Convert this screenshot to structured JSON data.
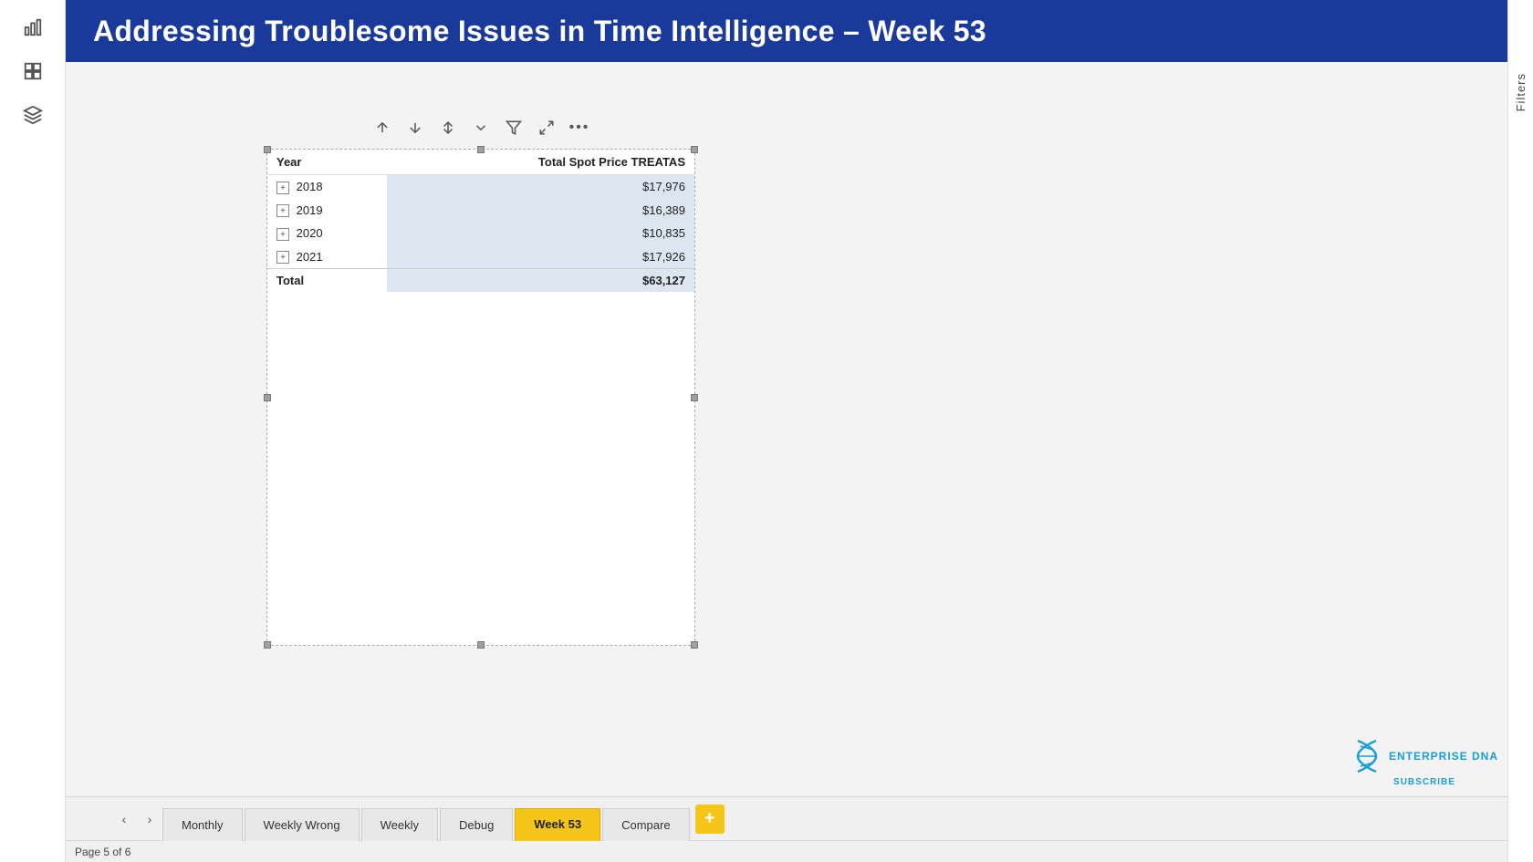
{
  "header": {
    "title": "Addressing Troublesome Issues in Time Intelligence – Week 53"
  },
  "sidebar": {
    "icons": [
      {
        "name": "bar-chart-icon",
        "symbol": "📊"
      },
      {
        "name": "grid-icon",
        "symbol": "⊞"
      },
      {
        "name": "layers-icon",
        "symbol": "⧉"
      }
    ]
  },
  "toolbar": {
    "icons": [
      {
        "name": "sort-asc-icon",
        "unicode": "↑"
      },
      {
        "name": "sort-desc-icon",
        "unicode": "↓"
      },
      {
        "name": "sort-both-icon",
        "unicode": "⇅"
      },
      {
        "name": "drill-down-icon",
        "unicode": "⬇"
      },
      {
        "name": "filter-icon",
        "unicode": "▽"
      },
      {
        "name": "expand-icon",
        "unicode": "⤢"
      },
      {
        "name": "more-icon",
        "unicode": "…"
      }
    ]
  },
  "matrix": {
    "columns": [
      {
        "key": "year",
        "label": "Year"
      },
      {
        "key": "price",
        "label": "Total Spot Price TREATAS"
      }
    ],
    "rows": [
      {
        "year": "2018",
        "price": "$17,976"
      },
      {
        "year": "2019",
        "price": "$16,389"
      },
      {
        "year": "2020",
        "price": "$10,835"
      },
      {
        "year": "2021",
        "price": "$17,926"
      }
    ],
    "total": {
      "label": "Total",
      "price": "$63,127"
    }
  },
  "tabs": [
    {
      "label": "Monthly",
      "active": false
    },
    {
      "label": "Weekly Wrong",
      "active": false
    },
    {
      "label": "Weekly",
      "active": false
    },
    {
      "label": "Debug",
      "active": false
    },
    {
      "label": "Week 53",
      "active": true
    },
    {
      "label": "Compare",
      "active": false
    }
  ],
  "status_bar": {
    "text": "Page 5 of 6"
  },
  "filters": {
    "label": "Filters"
  },
  "logo": {
    "name": "ENTERPRISE DNA",
    "subscribe": "SUBSCRIBE"
  }
}
